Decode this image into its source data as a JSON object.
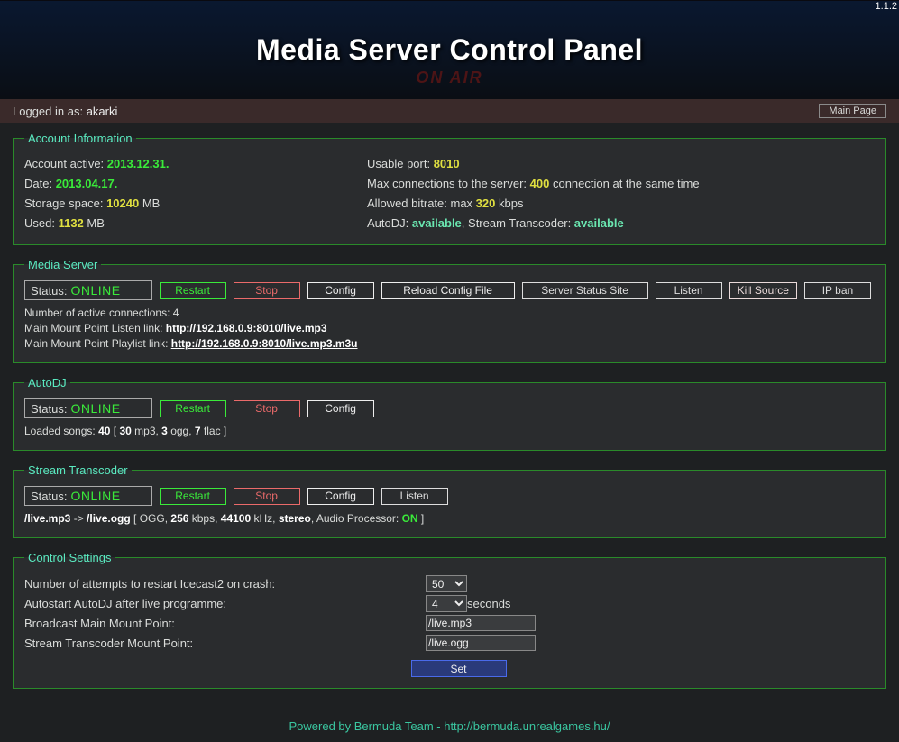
{
  "version": "1.1.2",
  "title": "Media Server Control Panel",
  "onair": "ON AIR",
  "login": {
    "prefix": "Logged in as: ",
    "user": "akarki",
    "mainpage": "Main Page"
  },
  "account": {
    "legend": "Account Information",
    "active_label": "Account active: ",
    "active": "2013.12.31.",
    "date_label": "Date: ",
    "date": "2013.04.17.",
    "storage_label": "Storage space: ",
    "storage": "10240",
    "storage_unit": " MB",
    "used_label": "Used: ",
    "used": "1132",
    "used_unit": " MB",
    "port_label": "Usable port: ",
    "port": "8010",
    "maxconn_label": "Max connections to the server: ",
    "maxconn": "400",
    "maxconn_suffix": " connection at the same time",
    "bitrate_label": "Allowed bitrate: max ",
    "bitrate": "320",
    "bitrate_unit": " kbps",
    "autodj_label": "AutoDJ: ",
    "autodj": "available",
    "sep": ", Stream Transcoder: ",
    "transcoder": "available"
  },
  "media": {
    "legend": "Media Server",
    "status_label": "Status: ",
    "status": "ONLINE",
    "restart": "Restart",
    "stop": "Stop",
    "config": "Config",
    "reload": "Reload Config File",
    "statussite": "Server Status Site",
    "listen": "Listen",
    "killsource": "Kill Source",
    "ipban": "IP ban",
    "active_label": "Number of active connections: ",
    "active": "4",
    "listen_label": "Main Mount Point Listen link: ",
    "listen_url": "http://192.168.0.9:8010/live.mp3",
    "playlist_label": "Main Mount Point Playlist link: ",
    "playlist_url": "http://192.168.0.9:8010/live.mp3.m3u"
  },
  "autodj": {
    "legend": "AutoDJ",
    "status_label": "Status: ",
    "status": "ONLINE",
    "restart": "Restart",
    "stop": "Stop",
    "config": "Config",
    "loaded_pre": "Loaded songs: ",
    "total": "40",
    "br1": " [ ",
    "mp3": "30",
    "mp3t": " mp3, ",
    "ogg": "3",
    "oggt": " ogg, ",
    "flac": "7",
    "flact": " flac ]"
  },
  "transcoder": {
    "legend": "Stream Transcoder",
    "status_label": "Status: ",
    "status": "ONLINE",
    "restart": "Restart",
    "stop": "Stop",
    "config": "Config",
    "listen": "Listen",
    "src": "/live.mp3",
    "arrow": " -> ",
    "dst": "/live.ogg",
    "sep1": "   [ OGG, ",
    "kbps": "256",
    "kbpst": " kbps, ",
    "khz": "44100",
    "khzt": " kHz, ",
    "stereo": "stereo",
    "ap": ", Audio Processor: ",
    "on": "ON",
    "end": " ]"
  },
  "settings": {
    "legend": "Control Settings",
    "restart_attempts_label": "Number of attempts to restart Icecast2 on crash:",
    "restart_attempts": "50",
    "autostart_label": "Autostart AutoDJ after live programme:",
    "autostart": "4",
    "autostart_unit": " seconds",
    "broadcast_label": "Broadcast Main Mount Point:",
    "broadcast": "/live.mp3",
    "transcoder_mount_label": "Stream Transcoder Mount Point:",
    "transcoder_mount": "/live.ogg",
    "set": "Set"
  },
  "footer": {
    "text": "Powered by Bermuda Team - ",
    "url": "http://bermuda.unrealgames.hu/"
  }
}
